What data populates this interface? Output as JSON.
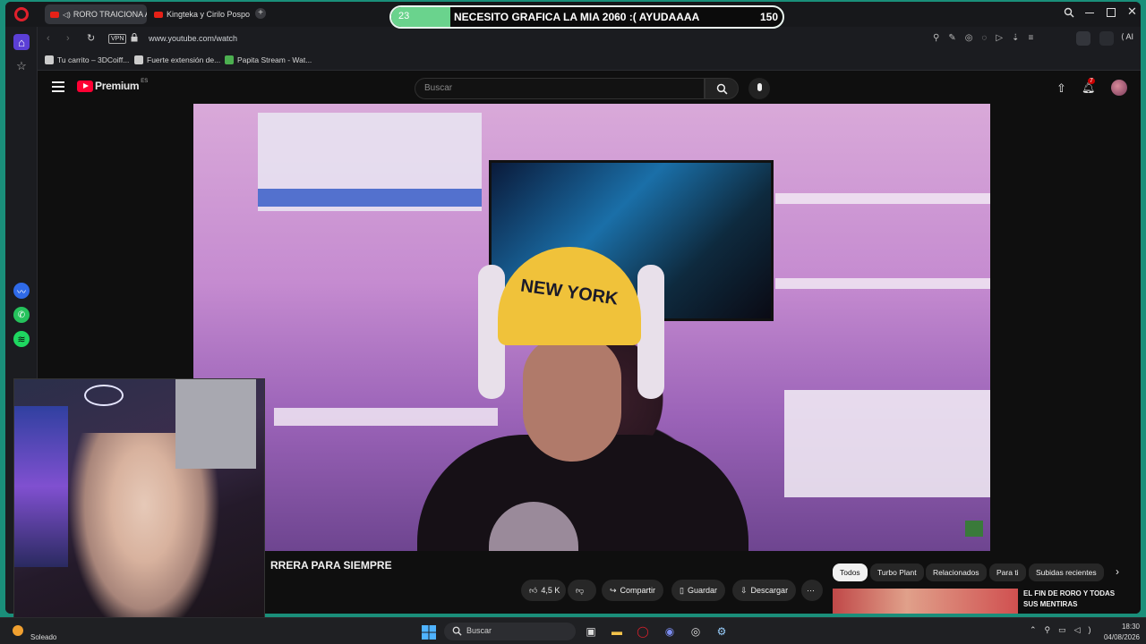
{
  "stream_overlay": {
    "left_count": "23",
    "message": "NECESITO GRAFICA LA MIA 2060 :( AYUDAAAA",
    "right_count": "150"
  },
  "browser": {
    "tabs": [
      {
        "label": "RORO TRAICIONA A P",
        "active": true
      },
      {
        "label": "Kingteka y Cirilo Pospo",
        "active": false
      }
    ],
    "vpn_label": "VPN",
    "url": "www.youtube.com/watch",
    "ai_label": "AI",
    "bookmarks": [
      {
        "label": "Tu carrito – 3DCoiff..."
      },
      {
        "label": "Fuerte extensión de..."
      },
      {
        "label": "Papita Stream - Wat..."
      }
    ]
  },
  "youtube": {
    "logo_text": "Premium",
    "region": "ES",
    "search_placeholder": "Buscar",
    "notification_count": "7",
    "video_title": "RRERA PARA SIEMPRE",
    "like_count": "4,5 K",
    "share_label": "Compartir",
    "save_label": "Guardar",
    "download_label": "Descargar",
    "chips": [
      {
        "label": "Todos",
        "active": true
      },
      {
        "label": "Turbo Plant",
        "active": false
      },
      {
        "label": "Relacionados",
        "active": false
      },
      {
        "label": "Para ti",
        "active": false
      },
      {
        "label": "Subidas recientes",
        "active": false
      }
    ],
    "recommended": {
      "title": "EL FIN DE RORO Y TODAS SUS MENTIRAS"
    },
    "video_scene_text": {
      "cap_text": "NEW YORK"
    }
  },
  "taskbar": {
    "weather": "Soleado",
    "search_placeholder": "Buscar",
    "time": "18:30",
    "date": "04/08/2026"
  },
  "colors": {
    "overlay_progress": "#6ad38d",
    "youtube_red": "#ff0033",
    "frame_teal": "#1a8f7a"
  }
}
